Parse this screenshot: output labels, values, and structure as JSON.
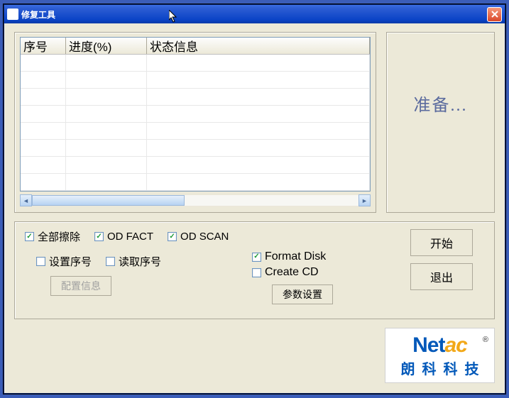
{
  "window": {
    "title": "修复工具"
  },
  "grid": {
    "columns": {
      "c1": "序号",
      "c2": "进度(%)",
      "c3": "状态信息"
    },
    "rows": []
  },
  "status_panel": {
    "text": "准备..."
  },
  "options": {
    "erase_all": {
      "label": "全部擦除",
      "checked": true
    },
    "od_fact": {
      "label": "OD FACT",
      "checked": true
    },
    "od_scan": {
      "label": "OD SCAN",
      "checked": true
    },
    "set_serial": {
      "label": "设置序号",
      "checked": false
    },
    "read_serial": {
      "label": "读取序号",
      "checked": false
    },
    "format_disk": {
      "label": "Format Disk",
      "checked": true
    },
    "create_cd": {
      "label": "Create CD",
      "checked": false
    }
  },
  "buttons": {
    "config": "配置信息",
    "params": "参数设置",
    "start": "开始",
    "exit": "退出"
  },
  "logo": {
    "brand_head": "Net",
    "brand_tail": "ac",
    "reg": "®",
    "company": "朗科科技"
  }
}
